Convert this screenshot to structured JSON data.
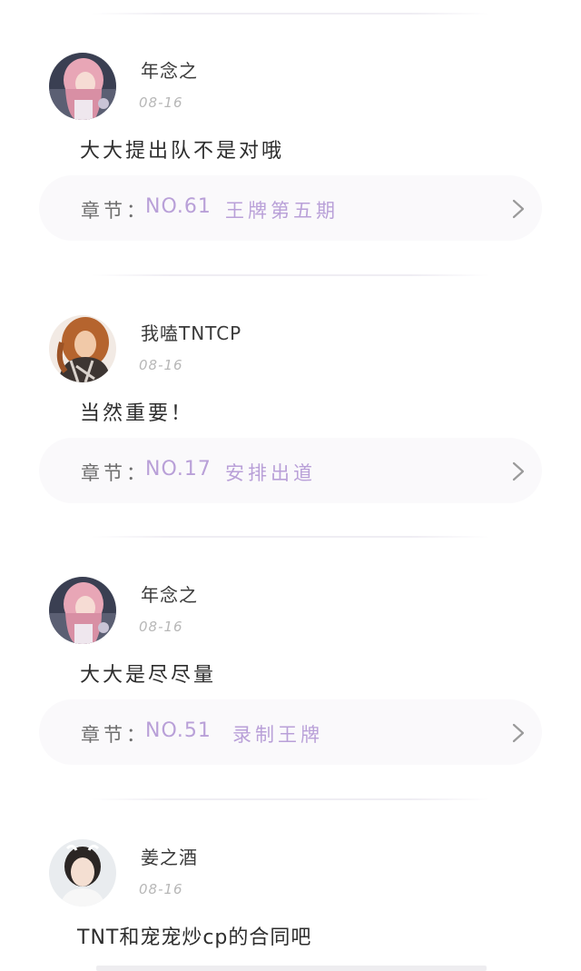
{
  "comments": [
    {
      "username": "年念之",
      "date": "08-16",
      "text": "大大提出队不是对哦",
      "chapter_prefix": "章节：",
      "chapter_no": "NO.61",
      "chapter_title": "王牌第五期",
      "avatar_icon": "user-avatar-pink-hair"
    },
    {
      "username": "我嗑TNTCP",
      "date": "08-16",
      "text": "当然重要！",
      "chapter_prefix": "章节：",
      "chapter_no": "NO.17",
      "chapter_title": "安排出道",
      "avatar_icon": "user-avatar-auburn-hair"
    },
    {
      "username": "年念之",
      "date": "08-16",
      "text": "大大是尽尽量",
      "chapter_prefix": "章节：",
      "chapter_no": "NO.51",
      "chapter_title": "录制王牌",
      "avatar_icon": "user-avatar-pink-hair"
    },
    {
      "username": "姜之酒",
      "date": "08-16",
      "text": "TNT和宠宠炒cp的合同吧",
      "avatar_icon": "user-avatar-dark-hair"
    }
  ],
  "colors": {
    "accent": "#b9a0d8",
    "card_bg": "#faf9fb",
    "date_gray": "#b7b7b7"
  },
  "icons": {
    "chevron": "chevron-right-icon"
  }
}
